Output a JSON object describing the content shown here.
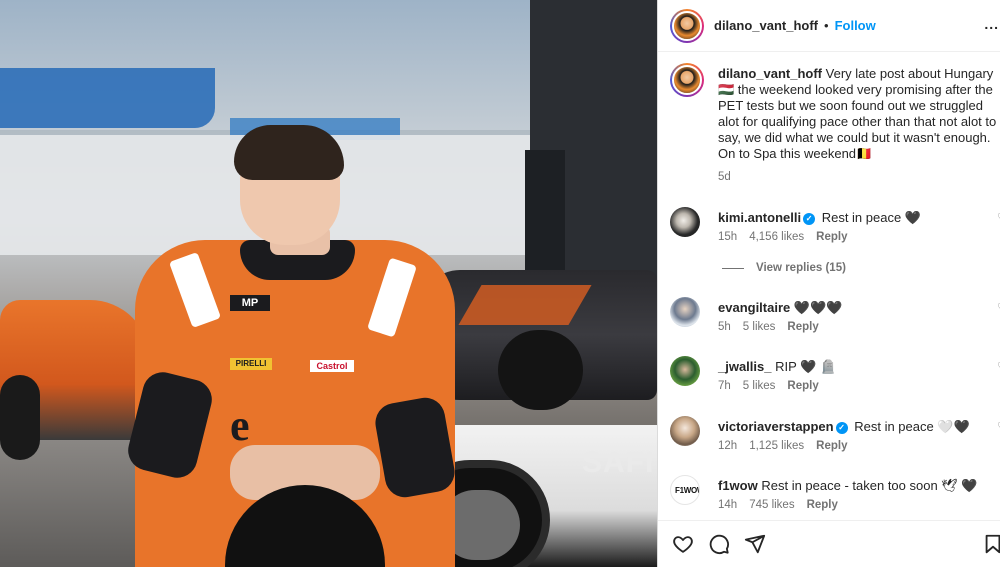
{
  "photo": {
    "description_icon": "race-driver-photo",
    "car_text": "SAFI"
  },
  "post": {
    "header": {
      "username": "dilano_vant_hoff",
      "separator": "•",
      "follow_label": "Follow",
      "more_label": "..."
    },
    "caption": {
      "username": "dilano_vant_hoff",
      "text": "Very late post about Hungary 🇭🇺 the weekend looked very promising after the PET tests but we soon found out we struggled alot for qualifying pace other than that not alot to say, we did what we could but it wasn't enough. On to Spa this weekend🇧🇪",
      "time": "5d"
    }
  },
  "comments": [
    {
      "username": "kimi.antonelli",
      "verified": true,
      "text": "Rest in peace 🖤",
      "time": "15h",
      "likes": "4,156 likes",
      "reply": "Reply"
    },
    {
      "username": "evangiltaire",
      "verified": false,
      "text": "🖤🖤🖤",
      "time": "5h",
      "likes": "5 likes",
      "reply": "Reply"
    },
    {
      "username": "_jwallis_",
      "verified": false,
      "text": "RIP 🖤 🪦",
      "time": "7h",
      "likes": "5 likes",
      "reply": "Reply"
    },
    {
      "username": "victoriaverstappen",
      "verified": true,
      "text": "Rest in peace 🤍🖤",
      "time": "12h",
      "likes": "1,125 likes",
      "reply": "Reply"
    },
    {
      "username": "f1wow",
      "verified": false,
      "text": "Rest in peace - taken too soon 🕊 🖤",
      "time": "14h",
      "likes": "745 likes",
      "reply": "Reply",
      "avatar_text": "F1WOW"
    }
  ],
  "view_replies_label": "View replies (15)",
  "actions": {
    "like_icon": "heart-icon",
    "comment_icon": "comment-icon",
    "share_icon": "send-icon",
    "save_icon": "bookmark-icon"
  },
  "colors": {
    "follow": "#0095f6",
    "text": "#262626",
    "muted": "#737373",
    "verified": "#0095f6"
  }
}
